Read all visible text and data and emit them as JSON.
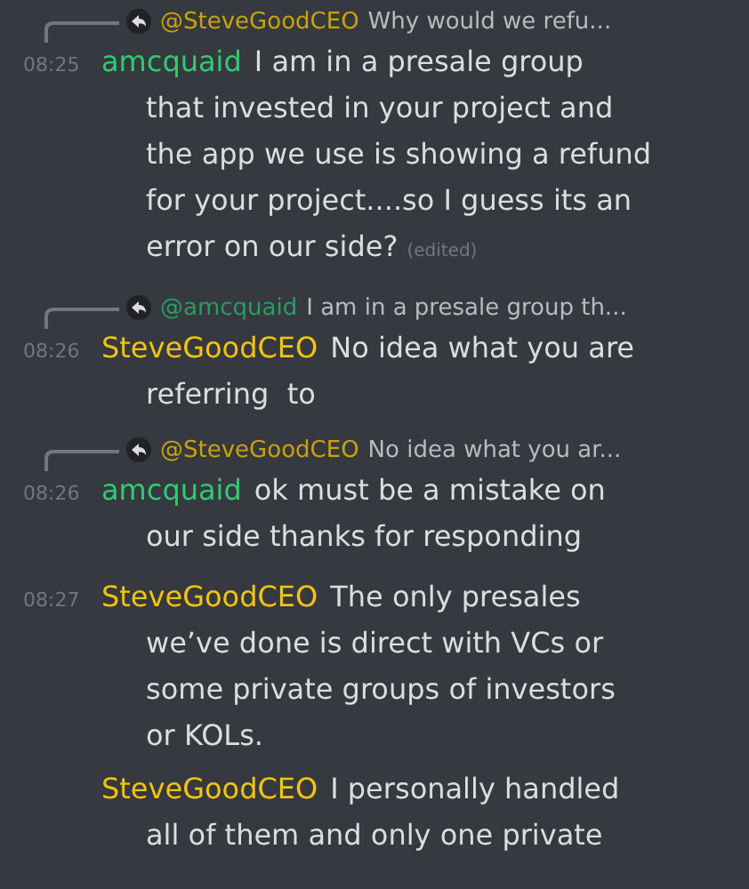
{
  "messages": [
    {
      "reply": {
        "author": "@SteveGoodCEO",
        "color": "#c9a30c",
        "text": "Why would we refu..."
      },
      "time": "08:25",
      "author": "amcquaid",
      "color": "#2ecc71",
      "lines": [
        "I am in a presale group",
        "that invested in your project and",
        "the app we use is showing a refund",
        "for your project....so I guess its an",
        "error on our side?"
      ],
      "edited_label": "(edited)"
    },
    {
      "reply": {
        "author": "@amcquaid",
        "color": "#2a9d62",
        "text": "I am in a presale group th..."
      },
      "time": "08:26",
      "author": "SteveGoodCEO",
      "color": "#f1c40f",
      "lines": [
        "No idea what you are",
        "referring  to"
      ]
    },
    {
      "reply": {
        "author": "@SteveGoodCEO",
        "color": "#c9a30c",
        "text": "No idea what you ar..."
      },
      "time": "08:26",
      "author": "amcquaid",
      "color": "#2ecc71",
      "lines": [
        "ok must be a mistake on",
        "our side thanks for responding"
      ]
    },
    {
      "time": "08:27",
      "author": "SteveGoodCEO",
      "color": "#f1c40f",
      "lines": [
        "The only presales",
        "we’ve done is direct with VCs or",
        "some private groups of investors",
        "or KOLs."
      ]
    },
    {
      "author": "SteveGoodCEO",
      "color": "#f1c40f",
      "lines": [
        "I personally handled",
        "all of them and only one private"
      ]
    }
  ]
}
